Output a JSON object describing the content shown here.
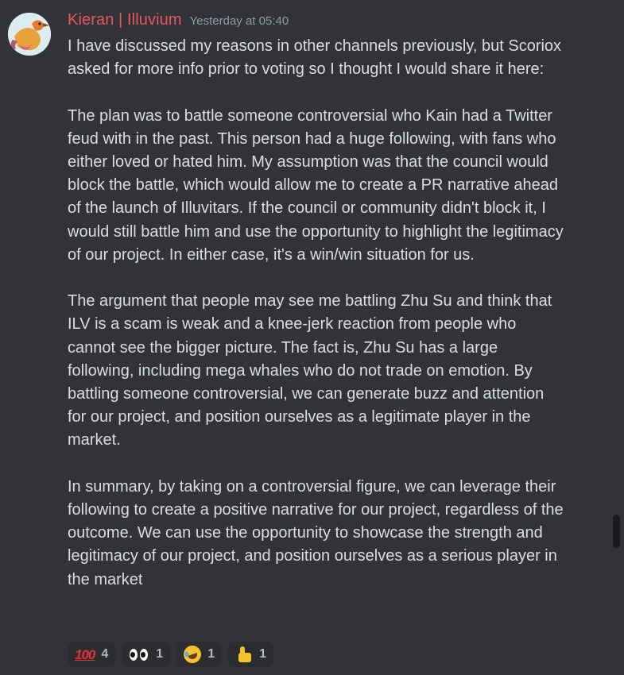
{
  "message": {
    "author": "Kieran | Illuvium",
    "timestamp": "Yesterday at 05:40",
    "paragraphs": [
      "I have discussed my reasons in other channels previously, but Scoriox asked for more info prior to voting so I thought I would share it here:",
      "The plan was to battle someone controversial who Kain had a Twitter feud with in the past. This person had a huge following, with fans who either loved or hated him. My assumption was that the council would block the battle, which would allow me to create a PR narrative ahead of the launch of Illuvitars. If the council or community didn't block it, I would still battle him and use the opportunity to highlight the legitimacy of our project. In either case, it's a win/win situation for us.",
      "The argument that people may see me battling Zhu Su and think that ILV is a scam is weak and a knee-jerk reaction from people who cannot see the bigger picture. The fact is, Zhu Su has a large following, including mega whales who do not trade on emotion. By battling someone controversial, we can generate buzz and attention for our project, and position ourselves as a legitimate player in the market.",
      "In summary, by taking on a controversial figure, we can leverage their following to create a positive narrative for our project, regardless of the outcome. We can use the opportunity to showcase the strength and legitimacy of our project, and position ourselves as a serious player in the market"
    ]
  },
  "reactions": [
    {
      "icon": "hundred-points-icon",
      "glyph": "100",
      "count": "4"
    },
    {
      "icon": "eyes-icon",
      "count": "1"
    },
    {
      "icon": "rolling-on-floor-laughing-icon",
      "count": "1"
    },
    {
      "icon": "thumbs-up-icon",
      "count": "1"
    }
  ],
  "colors": {
    "background": "#313338",
    "username": "#e8565e",
    "timestamp": "#949ba4",
    "text": "#dbdee1",
    "reaction_bg": "#2b2d31"
  }
}
